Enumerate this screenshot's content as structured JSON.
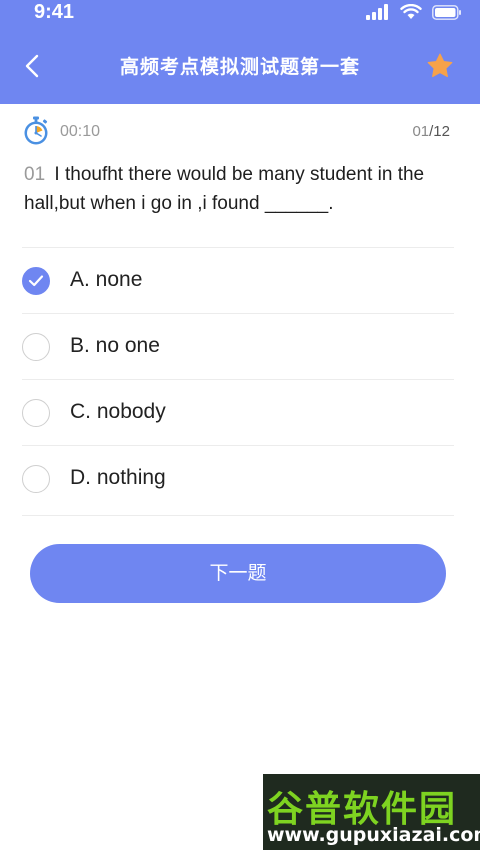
{
  "status_bar": {
    "time": "9:41"
  },
  "nav": {
    "title": "高频考点模拟测试题第一套"
  },
  "timer": {
    "elapsed": "00:10"
  },
  "progress": {
    "current": "01",
    "total": "/12"
  },
  "question": {
    "number": "01",
    "text": "I thoufht there would be many student in the hall,but when i go in ,i found ______."
  },
  "options": [
    {
      "label": "A. none",
      "selected": true
    },
    {
      "label": "B. no one",
      "selected": false
    },
    {
      "label": "C. nobody",
      "selected": false
    },
    {
      "label": "D. nothing",
      "selected": false
    }
  ],
  "next_button": {
    "label": "下一题"
  },
  "watermark": {
    "logo": "谷普软件园",
    "url": "www.gupuxiazai.com"
  },
  "colors": {
    "accent": "#6F86F1",
    "star": "#F7A24B",
    "watermark_green": "#7ED321"
  },
  "icons": [
    "signal-icon",
    "wifi-icon",
    "battery-icon",
    "back-chevron-icon",
    "star-icon",
    "stopwatch-icon",
    "check-icon"
  ]
}
